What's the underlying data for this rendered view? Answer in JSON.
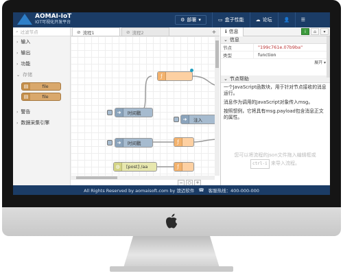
{
  "header": {
    "brand_title": "AOMAI-IoT",
    "brand_subtitle": "IOT可视化开发平台",
    "deploy_label": "部署",
    "nav": [
      {
        "label": "盒子性能"
      },
      {
        "label": "论坛"
      }
    ]
  },
  "palette": {
    "search_placeholder": "过滤节点",
    "categories": [
      {
        "label": "输入"
      },
      {
        "label": "输出"
      },
      {
        "label": "功能"
      },
      {
        "label": "存储"
      },
      {
        "label": "警告"
      },
      {
        "label": "数据采集引擎"
      }
    ],
    "storage_nodes": [
      {
        "label": "file"
      },
      {
        "label": "file"
      }
    ]
  },
  "workspace": {
    "tabs": [
      {
        "label": "流程1"
      },
      {
        "label": "流程2"
      }
    ],
    "nodes": [
      {
        "label": "时间戳"
      },
      {
        "label": "注入"
      },
      {
        "label": "时间戳"
      },
      {
        "label": "[post] /aa"
      }
    ]
  },
  "sidebar": {
    "tab_label": "信息",
    "section_info": "信息",
    "props": [
      {
        "key": "节点",
        "value": "\"199c761e.07b9ba\""
      },
      {
        "key": "类型",
        "value": "function"
      }
    ],
    "more_label": "展开",
    "section_help": "节点帮助",
    "help_lines": [
      "一个JavaScript函数块，用于针对节点接收的消息运行。",
      "消息作为调用的JavaScript对象传入msg。",
      "按照惯例，它将具有msg.payload包含消息正文的属性。"
    ],
    "drop_hint_1": "您可以将流程的json文件拖入编辑框或",
    "drop_hint_key": "ctrl-i",
    "drop_hint_2": "来导入流程。"
  },
  "footer": {
    "copyright": "All Rights Reserved by aomaisoft.com by 澳迈软件",
    "hotline": "客服热线：400-000-000"
  },
  "colors": {
    "header_bg": "#1b3c66",
    "inject_node": "#a6bbcf",
    "function_node": "#fdd0a2",
    "http_node": "#e7e7ae",
    "info_button": "#3c9a3c"
  }
}
